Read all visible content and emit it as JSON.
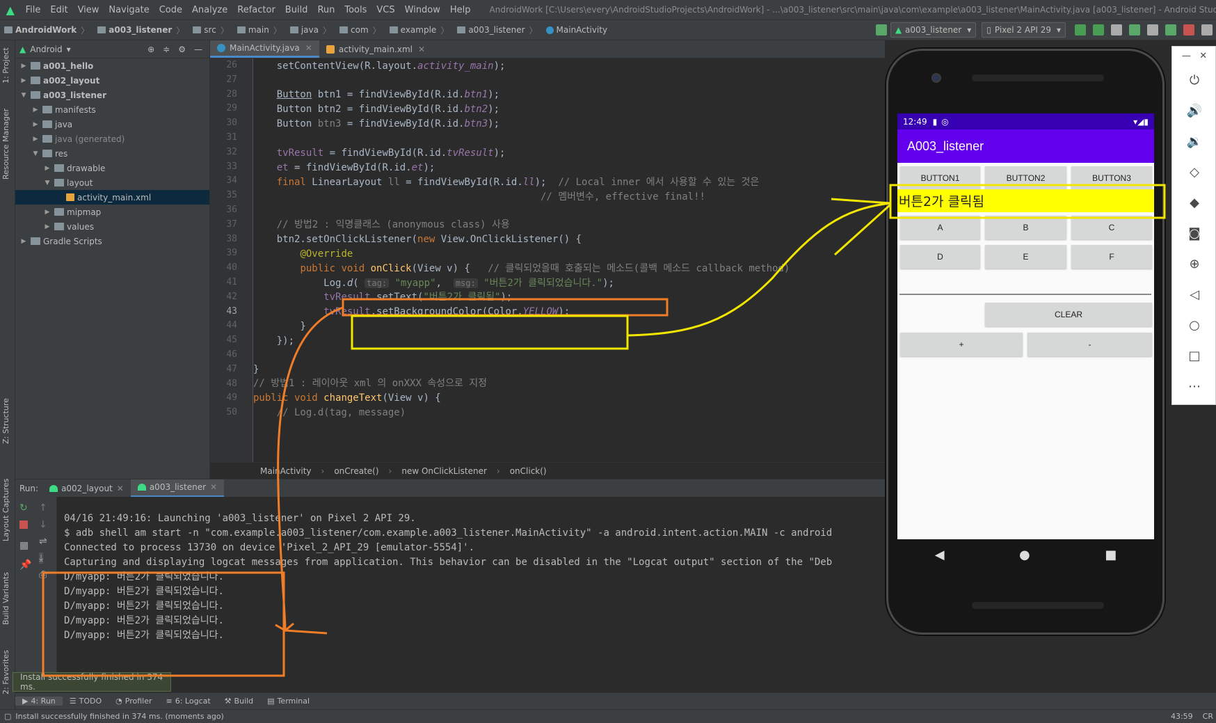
{
  "menubar": {
    "items": [
      "File",
      "Edit",
      "View",
      "Navigate",
      "Code",
      "Analyze",
      "Refactor",
      "Build",
      "Run",
      "Tools",
      "VCS",
      "Window",
      "Help"
    ],
    "title": "AndroidWork [C:\\Users\\every\\AndroidStudioProjects\\AndroidWork] - ...\\a003_listener\\src\\main\\java\\com\\example\\a003_listener\\MainActivity.java [a003_listener] - Android Studio"
  },
  "navbar": {
    "crumbs": [
      "AndroidWork",
      "a003_listener",
      "src",
      "main",
      "java",
      "com",
      "example",
      "a003_listener",
      "MainActivity"
    ],
    "run_config": "a003_listener",
    "device": "Pixel 2 API 29"
  },
  "leftstripe": {
    "tabs": [
      "1: Project",
      "Resource Manager",
      "Z: Structure",
      "Layout Captures",
      "Build Variants",
      "2: Favorites"
    ]
  },
  "project": {
    "view": "Android",
    "tree": [
      {
        "label": "a001_hello",
        "depth": 0,
        "arrow": "▶",
        "bold": true
      },
      {
        "label": "a002_layout",
        "depth": 0,
        "arrow": "▶",
        "bold": true
      },
      {
        "label": "a003_listener",
        "depth": 0,
        "arrow": "▼",
        "bold": true
      },
      {
        "label": "manifests",
        "depth": 1,
        "arrow": "▶"
      },
      {
        "label": "java",
        "depth": 1,
        "arrow": "▶"
      },
      {
        "label": "java (generated)",
        "depth": 1,
        "arrow": "▶",
        "dim": true
      },
      {
        "label": "res",
        "depth": 1,
        "arrow": "▼"
      },
      {
        "label": "drawable",
        "depth": 2,
        "arrow": "▶"
      },
      {
        "label": "layout",
        "depth": 2,
        "arrow": "▼"
      },
      {
        "label": "activity_main.xml",
        "depth": 3,
        "arrow": "",
        "selected": true
      },
      {
        "label": "mipmap",
        "depth": 2,
        "arrow": "▶"
      },
      {
        "label": "values",
        "depth": 2,
        "arrow": "▶"
      },
      {
        "label": "Gradle Scripts",
        "depth": 0,
        "arrow": "▶"
      }
    ]
  },
  "editor": {
    "tabs": [
      {
        "label": "MainActivity.java",
        "active": true
      },
      {
        "label": "activity_main.xml",
        "active": false
      }
    ],
    "line_numbers": [
      "26",
      "27",
      "28",
      "29",
      "30",
      "31",
      "32",
      "33",
      "34",
      "35",
      "36",
      "37",
      "38",
      "39",
      "40",
      "41",
      "42",
      "43",
      "44",
      "45",
      "46",
      "47",
      "48",
      "49",
      "50"
    ],
    "breadcrumb": [
      "MainActivity",
      "onCreate()",
      "new OnClickListener",
      "onClick()"
    ]
  },
  "run": {
    "label": "Run:",
    "tabs": [
      {
        "label": "a002_layout",
        "active": false
      },
      {
        "label": "a003_listener",
        "active": true
      }
    ],
    "console": [
      "04/16 21:49:16: Launching 'a003_listener' on Pixel 2 API 29.",
      "$ adb shell am start -n \"com.example.a003_listener/com.example.a003_listener.MainActivity\" -a android.intent.action.MAIN -c android",
      "Connected to process 13730 on device 'Pixel_2_API_29 [emulator-5554]'.",
      "Capturing and displaying logcat messages from application. This behavior can be disabled in the \"Logcat output\" section of the \"Deb",
      "D/myapp: 버튼2가 클릭되었습니다.",
      "D/myapp: 버튼2가 클릭되었습니다.",
      "D/myapp: 버튼2가 클릭되었습니다.",
      "D/myapp: 버튼2가 클릭되었습니다.",
      "D/myapp: 버튼2가 클릭되었습니다."
    ],
    "toast": "Install successfully finished in 374 ms."
  },
  "bottom": {
    "tabs": [
      "4: Run",
      "TODO",
      "Profiler",
      "6: Logcat",
      "Build",
      "Terminal"
    ],
    "status": "Install successfully finished in 374 ms. (moments ago)",
    "position": "43:59",
    "encoding": "CR"
  },
  "phone": {
    "time": "12:49",
    "app_title": "A003_listener",
    "buttons_row1": [
      "BUTTON1",
      "BUTTON2",
      "BUTTON3"
    ],
    "result_text": "버튼2가 클릭됨",
    "buttons_row2": [
      "A",
      "B",
      "C"
    ],
    "buttons_row3": [
      "D",
      "E",
      "F"
    ],
    "clear": "CLEAR",
    "plus": "+",
    "minus": "-",
    "nav": {
      "back": "◀",
      "home": "●",
      "recent": "■"
    }
  },
  "emulator_toolbar": {
    "icons": [
      "power-icon",
      "volume-up-icon",
      "volume-down-icon",
      "rotate-left-icon",
      "rotate-right-icon",
      "camera-icon",
      "zoom-icon",
      "back-icon",
      "home-icon",
      "overview-icon",
      "more-icon"
    ]
  },
  "colors": {
    "annotation_orange": "#f07d28",
    "annotation_yellow": "#f2e600",
    "app_primary": "#6200ee",
    "app_primary_dark": "#3700b3",
    "result_bg": "#ffff00"
  }
}
